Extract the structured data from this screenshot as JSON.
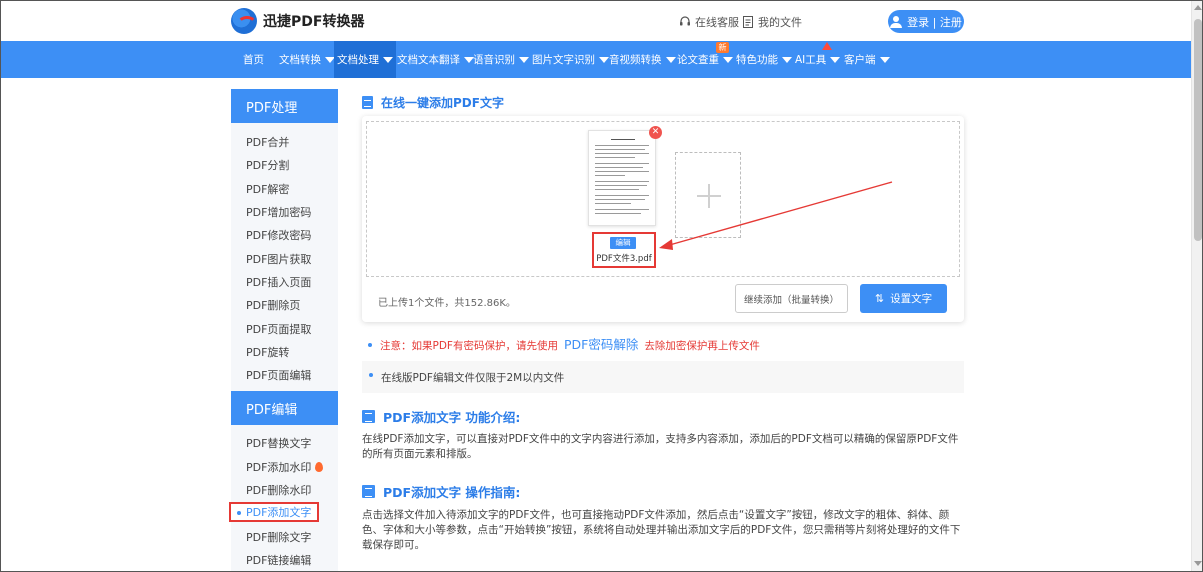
{
  "header": {
    "logo_text": "迅捷PDF转换器",
    "links": [
      {
        "label": "在线客服",
        "icon": "headset-icon"
      },
      {
        "label": "我的文件",
        "icon": "file-list-icon"
      }
    ],
    "login_label": "登录 | 注册"
  },
  "nav": {
    "items": [
      {
        "label": "首页",
        "has_caret": false
      },
      {
        "label": "文档转换",
        "has_caret": true
      },
      {
        "label": "文档处理",
        "has_caret": true,
        "active": true
      },
      {
        "label": "文档文本翻译",
        "has_caret": true
      },
      {
        "label": "语音识别",
        "has_caret": true
      },
      {
        "label": "图片文字识别",
        "has_caret": true
      },
      {
        "label": "音视频转换",
        "has_caret": true
      },
      {
        "label": "论文查重",
        "has_caret": true
      },
      {
        "label": "特色功能",
        "has_caret": true
      },
      {
        "label": "AI工具",
        "has_caret": true
      },
      {
        "label": "客户端",
        "has_caret": true
      }
    ],
    "new_badge": "新",
    "colors": {
      "bar": "#3d8ff5",
      "active": "#1f6fd6"
    }
  },
  "sidebar": {
    "group1_title": "PDF处理",
    "group1_items": [
      "PDF合并",
      "PDF分割",
      "PDF解密",
      "PDF增加密码",
      "PDF修改密码",
      "PDF图片获取",
      "PDF插入页面",
      "PDF删除页",
      "PDF页面提取",
      "PDF旋转",
      "PDF页面编辑"
    ],
    "group2_title": "PDF编辑",
    "group2_items": [
      "PDF替换文字",
      "PDF添加水印",
      "PDF删除水印",
      "PDF添加文字",
      "PDF删除文字",
      "PDF链接编辑"
    ],
    "selected_item": "PDF添加文字"
  },
  "main": {
    "title": "在线一键添加PDF文字",
    "file": {
      "edit_label": "编辑",
      "name": "PDF文件3.pdf",
      "remove_glyph": "✕"
    },
    "upload_status": "已上传1个文件，共152.86K。",
    "continue_label": "继续添加（批量转换）",
    "settext_label": "设置文字",
    "note_prefix": "注意：如果PDF有密码保护，请先使用",
    "note_link": "PDF密码解除",
    "note_suffix": "去除加密保护再上传文件",
    "limit_text": "在线版PDF编辑文件仅限于2M以内文件",
    "intro_title": "PDF添加文字 功能介绍:",
    "intro_text": "在线PDF添加文字，可以直接对PDF文件中的文字内容进行添加，支持多内容添加，添加后的PDF文档可以精确的保留原PDF文件的所有页面元素和排版。",
    "guide_title": "PDF添加文字 操作指南:",
    "guide_text": "点击选择文件加入待添加文字的PDF文件，也可直接拖动PDF文件添加，然后点击“设置文字”按钮，修改文字的粗体、斜体、颜色、字体和大小等参数，点击“开始转换”按钮，系统将自动处理并输出添加文字后的PDF文件，您只需稍等片刻将处理好的文件下载保存即可。"
  },
  "colors": {
    "accent": "#3d8ff5",
    "highlight": "#e53935",
    "warning_text": "#e53935"
  }
}
